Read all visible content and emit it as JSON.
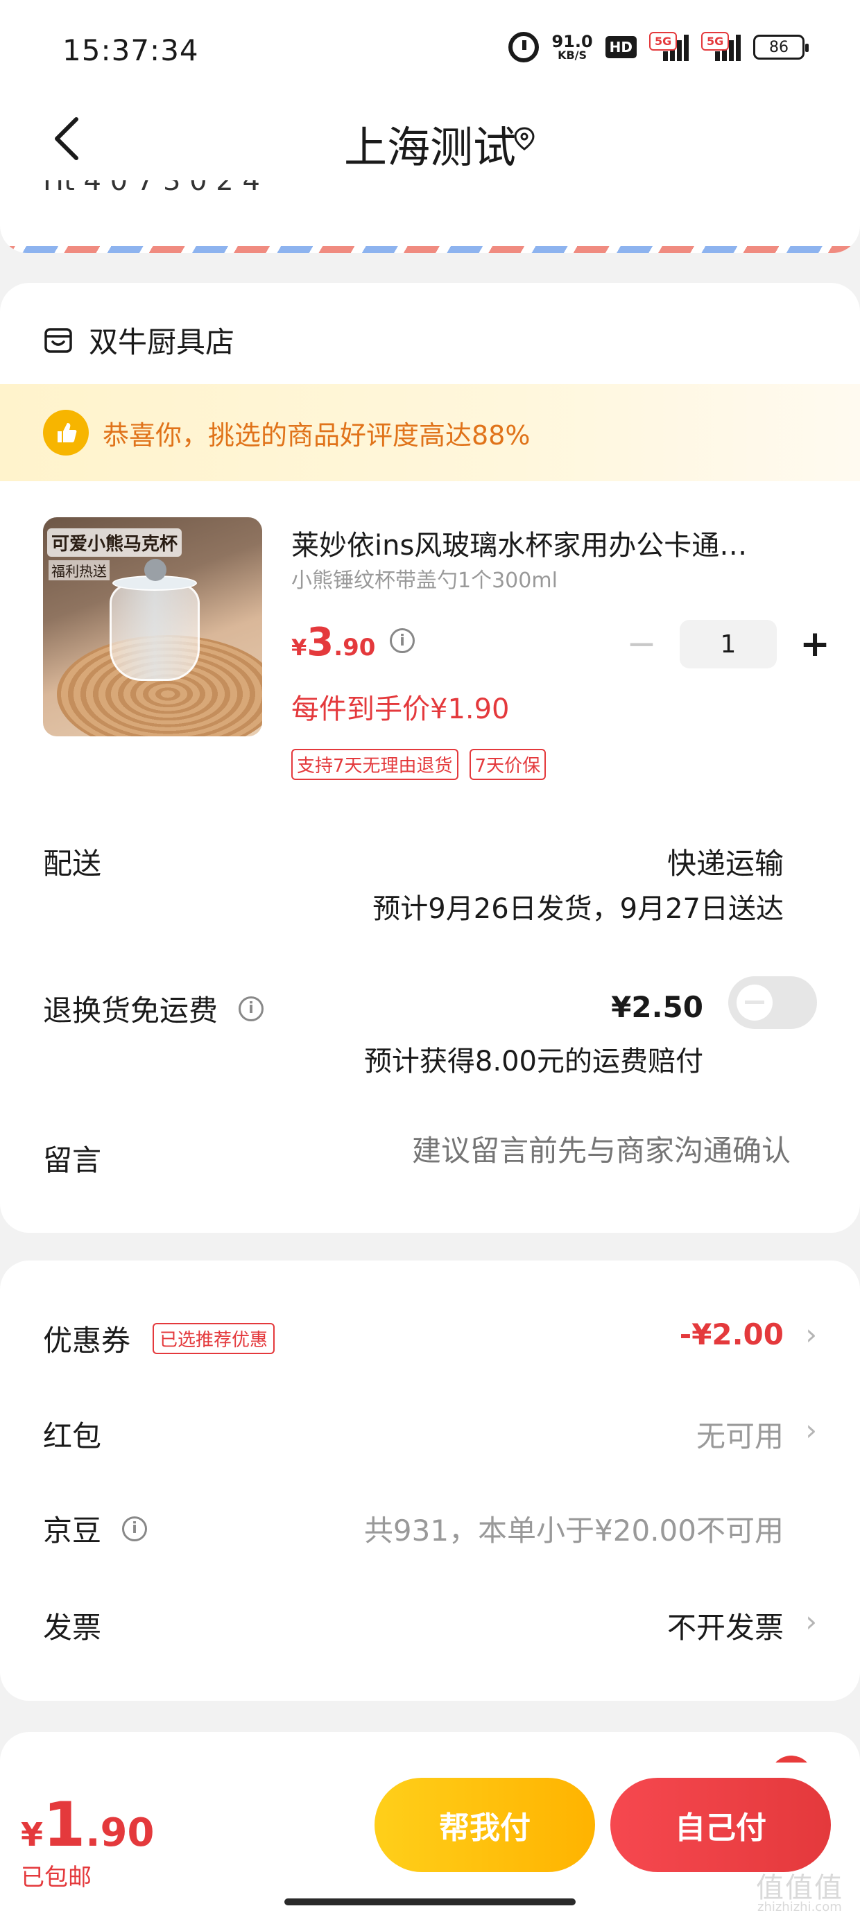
{
  "status_bar": {
    "time": "15:37:34",
    "net_speed": "91.0",
    "net_unit": "KB/S",
    "hd_badge": "HD",
    "sim1_tag": "5G",
    "sim2_tag": "5G",
    "battery": "86"
  },
  "nav": {
    "title": "上海测试"
  },
  "address": {
    "cut_text": "Ht 4 0 7    3 0 2 4"
  },
  "store": {
    "name": "双牛厨具店",
    "praise": "恭喜你，挑选的商品好评度高达88%",
    "product": {
      "image_banner": "可爱小熊马克杯",
      "image_banner2": "福利热送",
      "title": "莱妙依ins风玻璃水杯家用办公卡通…",
      "spec": "小熊锤纹杯带盖勺1个300ml",
      "price_symbol": "¥",
      "price_int": "3",
      "price_dec": ".90",
      "unit_price": "每件到手价¥1.90",
      "quantity": "1",
      "tags": [
        "支持7天无理由退货",
        "7天价保"
      ]
    },
    "delivery": {
      "label": "配送",
      "method": "快递运输",
      "estimate": "预计9月26日发货，9月27日送达"
    },
    "return_shipping": {
      "label": "退换货免运费",
      "price": "¥2.50",
      "note": "预计获得8.00元的运费赔付",
      "enabled": false
    },
    "message": {
      "label": "留言",
      "placeholder": "建议留言前先与商家沟通确认"
    }
  },
  "payment": {
    "coupon": {
      "label": "优惠券",
      "tag": "已选推荐优惠",
      "value": "-¥2.00"
    },
    "red_packet": {
      "label": "红包",
      "value": "无可用"
    },
    "jd_beans": {
      "label": "京豆",
      "value": "共931，本单小于¥20.00不可用"
    },
    "invoice": {
      "label": "发票",
      "value": "不开发票"
    }
  },
  "bottom": {
    "total_symbol": "¥",
    "total_int": "1",
    "total_dec": ".90",
    "shipping_note": "已包邮",
    "help_pay_label": "帮我付",
    "self_pay_label": "自己付"
  },
  "watermark": {
    "text": "值值值",
    "sub": "zhizhizhi.com"
  },
  "colors": {
    "accent_red": "#e4393c",
    "help_pay_yellow": "#ffb300",
    "praise_orange": "#e0731a",
    "muted_gray": "#999999"
  },
  "icons": {
    "back": "chevron-left-icon",
    "location": "location-pin-icon",
    "store": "store-icon",
    "praise": "thumbs-up-icon",
    "info": "info-icon",
    "chevron": "chevron-right-icon"
  }
}
